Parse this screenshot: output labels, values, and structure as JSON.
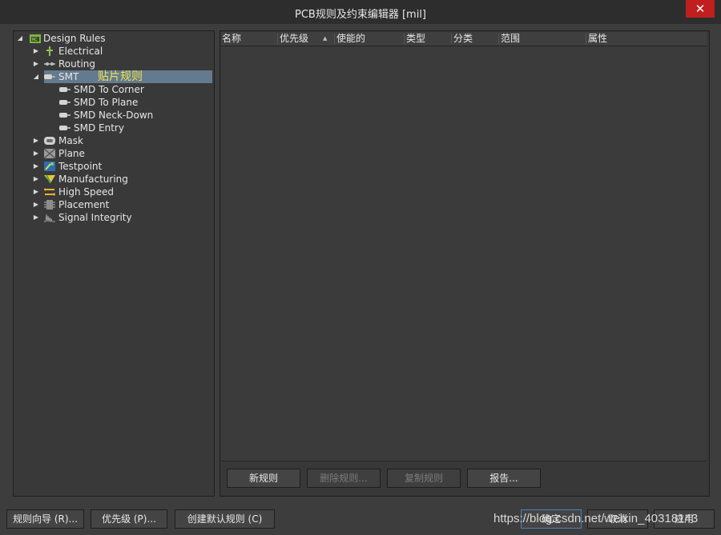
{
  "window": {
    "title": "PCB规则及约束编辑器 [mil]",
    "close_label": "✕"
  },
  "tree": {
    "root": "Design Rules",
    "items": [
      {
        "label": "Electrical",
        "icon": "electrical-icon"
      },
      {
        "label": "Routing",
        "icon": "routing-icon"
      },
      {
        "label": "SMT",
        "icon": "smt-icon",
        "selected": true,
        "expanded": true
      },
      {
        "label": "SMD To Corner",
        "icon": "smd-icon"
      },
      {
        "label": "SMD To Plane",
        "icon": "smd-icon"
      },
      {
        "label": "SMD Neck-Down",
        "icon": "smd-icon"
      },
      {
        "label": "SMD Entry",
        "icon": "smd-icon"
      },
      {
        "label": "Mask",
        "icon": "mask-icon"
      },
      {
        "label": "Plane",
        "icon": "plane-icon"
      },
      {
        "label": "Testpoint",
        "icon": "testpoint-icon"
      },
      {
        "label": "Manufacturing",
        "icon": "manufacturing-icon"
      },
      {
        "label": "High Speed",
        "icon": "high-speed-icon"
      },
      {
        "label": "Placement",
        "icon": "placement-icon"
      },
      {
        "label": "Signal Integrity",
        "icon": "signal-integrity-icon"
      }
    ],
    "annotation": "贴片规则"
  },
  "grid": {
    "columns": [
      "名称",
      "优先级",
      "使能的",
      "类型",
      "分类",
      "范围",
      "属性"
    ],
    "sort_indicator": "▲"
  },
  "panel_buttons": {
    "new_rule": "新规则",
    "delete_rule": "删除规则...",
    "copy_rule": "复制规则",
    "report": "报告..."
  },
  "footer_buttons": {
    "rule_wizard": "规则向导 (R)...",
    "priority": "优先级 (P)...",
    "create_default": "创建默认规则 (C)",
    "ok": "确定",
    "cancel": "取消",
    "apply": "应用"
  },
  "watermark": "https://blog.csdn.net/weixin_40318143",
  "colors": {
    "selection": "#647a8f",
    "annotation": "#f1e64a",
    "close": "#c11f1f"
  }
}
